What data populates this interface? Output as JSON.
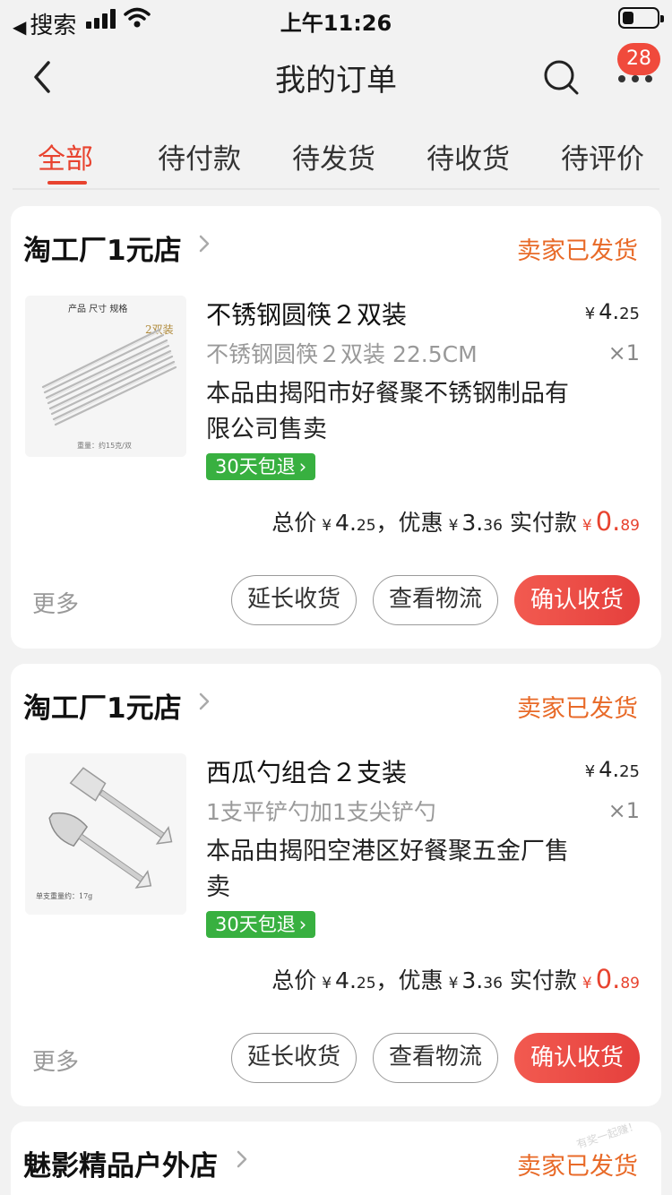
{
  "status_bar": {
    "back_app": "搜索",
    "time": "上午11:26"
  },
  "nav": {
    "title": "我的订单",
    "badge": "28",
    "icons": [
      "back-icon",
      "search-icon",
      "more-icon"
    ]
  },
  "tabs": [
    {
      "label": "全部",
      "active": true
    },
    {
      "label": "待付款",
      "active": false
    },
    {
      "label": "待发货",
      "active": false
    },
    {
      "label": "待收货",
      "active": false
    },
    {
      "label": "待评价",
      "active": false
    }
  ],
  "colors": {
    "accent": "#e8432f",
    "status": "#e86a28",
    "return_tag": "#38b040",
    "badge": "#f04a3c"
  },
  "orders": [
    {
      "shop": "淘工厂1元店",
      "status": "卖家已发货",
      "product": {
        "title": "不锈钢圆筷２双装",
        "price_yen": "¥",
        "price_int": "4.",
        "price_dec": "25",
        "spec": "不锈钢圆筷２双装 22.5CM",
        "qty": "×1",
        "seller": "本品由揭阳市好餐聚不锈钢制品有限公司售卖",
        "return_tag": "30天包退",
        "image_text": {
          "header": "产品 尺寸 规格",
          "tag": "2双装",
          "footer": "重量：约15克/双"
        }
      },
      "totals": {
        "total_label": "总价",
        "total_int": "4.",
        "total_dec": "25",
        "discount_label": "，优惠",
        "discount_int": "3.",
        "discount_dec": "36",
        "paid_label": "实付款",
        "paid_int": "0.",
        "paid_dec": "89",
        "yen": "¥"
      },
      "actions": {
        "more": "更多",
        "extend": "延长收货",
        "logistics": "查看物流",
        "confirm": "确认收货"
      }
    },
    {
      "shop": "淘工厂1元店",
      "status": "卖家已发货",
      "product": {
        "title": "西瓜勺组合２支装",
        "price_yen": "¥",
        "price_int": "4.",
        "price_dec": "25",
        "spec": "1支平铲勺加1支尖铲勺",
        "qty": "×1",
        "seller": "本品由揭阳空港区好餐聚五金厂售卖",
        "return_tag": "30天包退",
        "image_text": {
          "footer": "单支重量约：17g"
        }
      },
      "totals": {
        "total_label": "总价",
        "total_int": "4.",
        "total_dec": "25",
        "discount_label": "，优惠",
        "discount_int": "3.",
        "discount_dec": "36",
        "paid_label": "实付款",
        "paid_int": "0.",
        "paid_dec": "89",
        "yen": "¥"
      },
      "actions": {
        "more": "更多",
        "extend": "延长收货",
        "logistics": "查看物流",
        "confirm": "确认收货"
      }
    },
    {
      "shop": "魅影精品户外店",
      "status": "卖家已发货"
    }
  ],
  "watermark": "有奖一起赚！"
}
